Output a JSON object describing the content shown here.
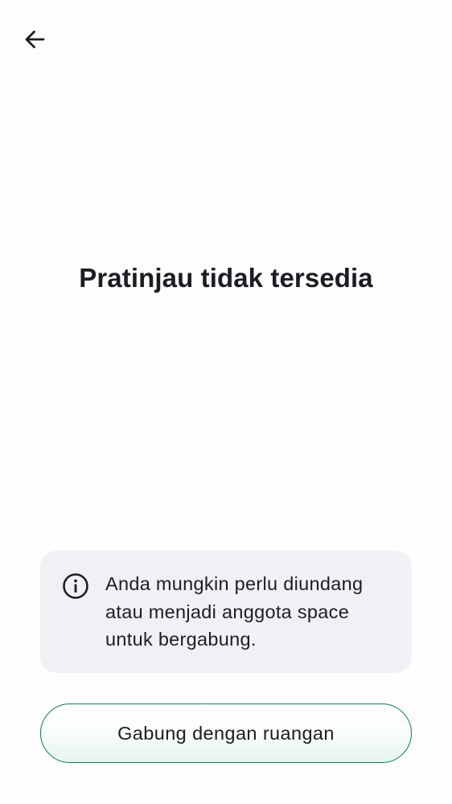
{
  "header": {
    "back_icon": "arrow-left-icon"
  },
  "main": {
    "title": "Pratinjau tidak tersedia"
  },
  "info_card": {
    "icon": "info-icon",
    "message": "Anda mungkin perlu diundang atau menjadi anggota space untuk bergabung."
  },
  "actions": {
    "join_label": "Gabung dengan ruangan"
  },
  "colors": {
    "accent": "#0e7a5b",
    "card_background": "#f0f1f5",
    "text": "#1b1d22"
  }
}
